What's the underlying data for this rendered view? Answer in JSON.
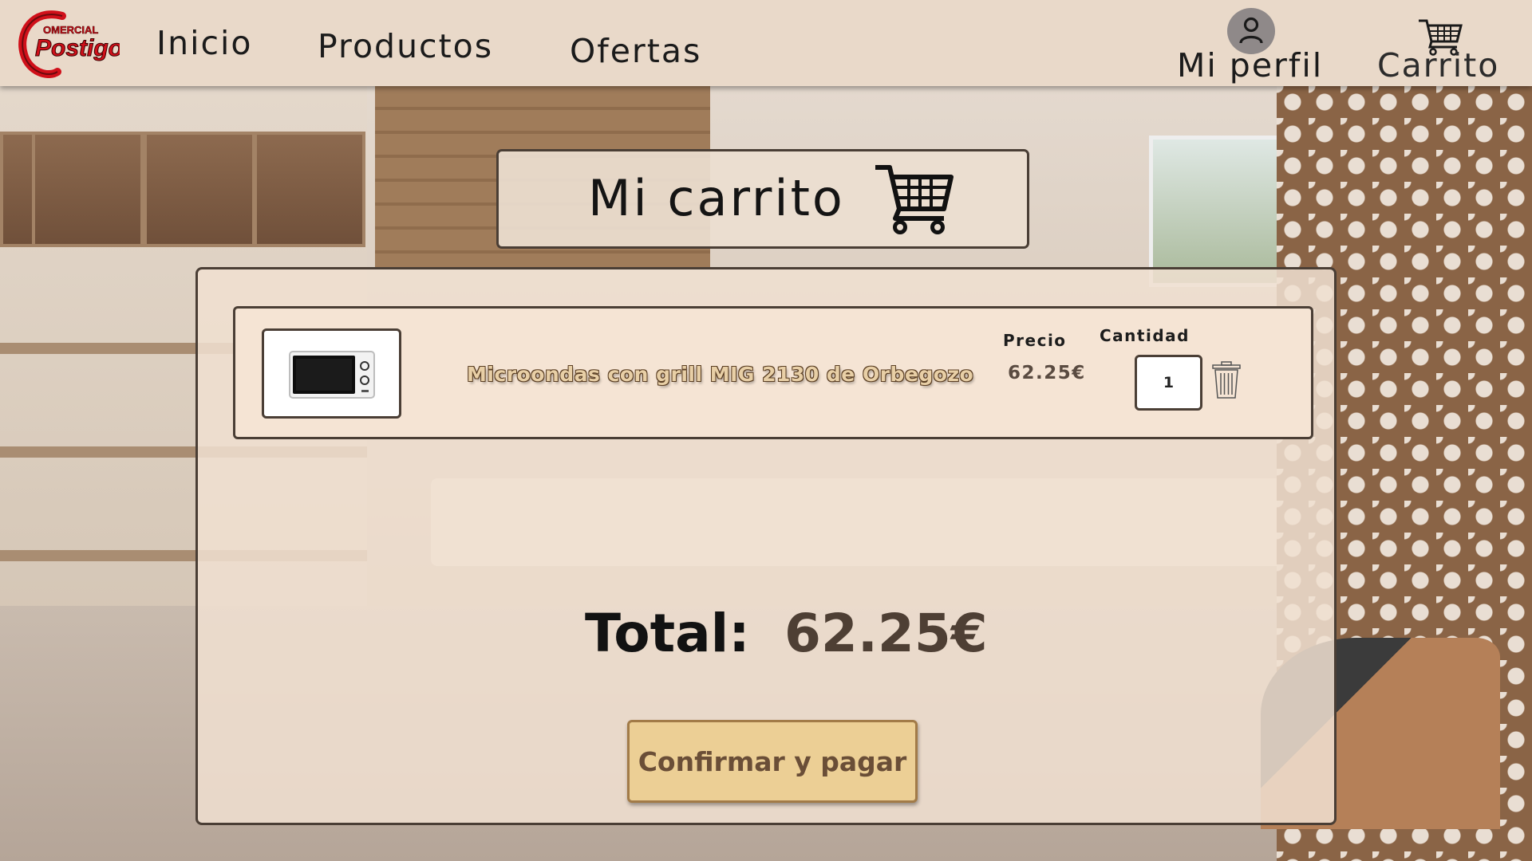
{
  "header": {
    "logo_text": "Comercial Postigo",
    "nav": {
      "inicio": "Inicio",
      "productos": "Productos",
      "ofertas": "Ofertas"
    },
    "profile_label": "Mi perfil",
    "cart_label": "Carrito"
  },
  "page": {
    "title": "Mi carrito"
  },
  "cart": {
    "price_header": "Precio",
    "quantity_header": "Cantidad",
    "items": [
      {
        "name": "Microondas con grill MIG 2130 de Orbegozo",
        "price": "62.25€",
        "quantity": "1"
      }
    ],
    "total_label": "Total:",
    "total_value": "62.25€",
    "pay_button": "Confirmar y pagar"
  },
  "icons": {
    "logo": "comercial-postigo-logo",
    "profile": "user-icon",
    "cart_nav": "cart-icon",
    "title_cart": "cart-icon",
    "delete": "trash-icon"
  },
  "colors": {
    "navbar": "#e9d9c9",
    "logo_red": "#d0101a",
    "button_fill": "#eccf95",
    "button_text": "#6a4e37",
    "panel_border": "#4a3e35"
  }
}
